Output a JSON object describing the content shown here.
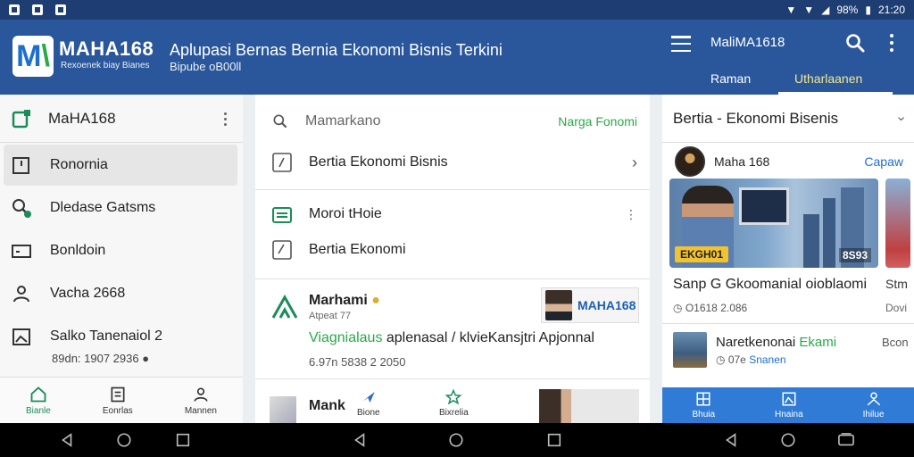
{
  "status": {
    "battery": "98%",
    "time": "21:20"
  },
  "header": {
    "brand": "MAHA168",
    "brand_sub": "Rexoenek biay Bianes",
    "title": "Aplupasi Bernas Bernia Ekonomi Bisnis Terkini",
    "subtitle": "Bipube oB00ll",
    "account_name": "MaliMA1618",
    "tabs": [
      "Raman",
      "Utharlaanen"
    ]
  },
  "left_panel": {
    "title": "MaHA168",
    "items": [
      {
        "label": "Ronornia",
        "icon": "folder-icon"
      },
      {
        "label": "Dledase Gatsms",
        "icon": "search-icon"
      },
      {
        "label": "Bonldoin",
        "icon": "card-icon"
      },
      {
        "label": "Vacha 2668",
        "icon": "user-icon"
      },
      {
        "label": "Salko Tanenaiol 2",
        "icon": "image-icon"
      }
    ],
    "item_sub": "89dn: 1907 2936",
    "bottom_nav": [
      "Bianle",
      "Eonrlas",
      "Mannen"
    ]
  },
  "middle_panel": {
    "search_placeholder": "Mamarkano",
    "search_link": "Narga Fonomi",
    "row1": "Bertia Ekonomi Bisnis",
    "row2": "Moroi tHoie",
    "row3": "Bertia Ekonomi",
    "news_title": "Marhami",
    "news_meta": "Atpeat 77",
    "news_line_green": "Viagnialaus",
    "news_line_rest": " aplenasal / klvieKansjtri Apjonnal",
    "news_time": "6.97n  5838 2 2050",
    "thumb_text": "MAHA168",
    "next_title": "Mank",
    "bottom_nav": [
      "Bione",
      "Bixrelia"
    ]
  },
  "right_panel": {
    "title": "Bertia - Ekonomi Bisenis",
    "author": "Maha 168",
    "author_link": "Capaw",
    "hero_tag": "EKGH01",
    "hero_num": "8S93",
    "caption": "Sanp G Gkoomanial oioblaomi",
    "caption2": "Stm",
    "meta": "O1618 2.086",
    "meta2": "Dovi",
    "item_title": "Naretkenonai",
    "item_title_green": " Ekami",
    "item_meta_num": "07e",
    "item_meta_link": "Snanen",
    "item_side": "Bcon",
    "bottom_nav": [
      "Bhuia",
      "Hnaina",
      "Ihilue"
    ]
  }
}
